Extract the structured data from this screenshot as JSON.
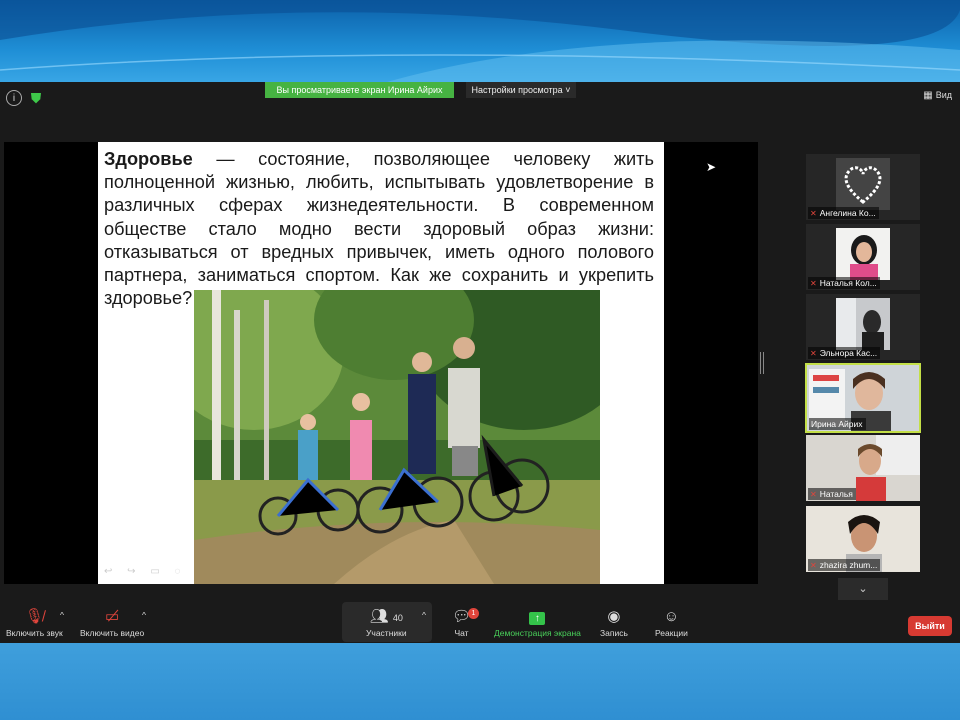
{
  "top_bar": {
    "viewing_banner": "Вы просматриваете экран Ирина Айрих",
    "view_settings_label": "Настройки просмотра",
    "view_label": "Вид"
  },
  "slide": {
    "term": "Здоровье",
    "text": " — состояние, позволяющее человеку жить полноценной жизнью, любить, испытывать удовлетворение в различных сферах жизнедеятельности. В современном обществе стало модно вести здоровый образ жизни: отказываться от вредных привычек, иметь одного полового партнера, заниматься спортом. Как же сохранить и укрепить здоровье?"
  },
  "participants": [
    {
      "name": "Ангелина Ко..."
    },
    {
      "name": "Наталья Кол..."
    },
    {
      "name": "Эльнора Кас..."
    },
    {
      "name": "Ирина Айрих"
    },
    {
      "name": "Наталья"
    },
    {
      "name": "zhazira zhum..."
    }
  ],
  "toolbar": {
    "unmute_label": "Включить звук",
    "start_video_label": "Включить видео",
    "participants_label": "Участники",
    "participants_count": "40",
    "chat_label": "Чат",
    "chat_badge": "1",
    "share_label": "Демонстрация экрана",
    "record_label": "Запись",
    "reactions_label": "Реакции",
    "leave_label": "Выйти"
  },
  "colors": {
    "active_speaker_border": "#c3df47",
    "share_green": "#46b342",
    "leave_red": "#d73a32"
  }
}
